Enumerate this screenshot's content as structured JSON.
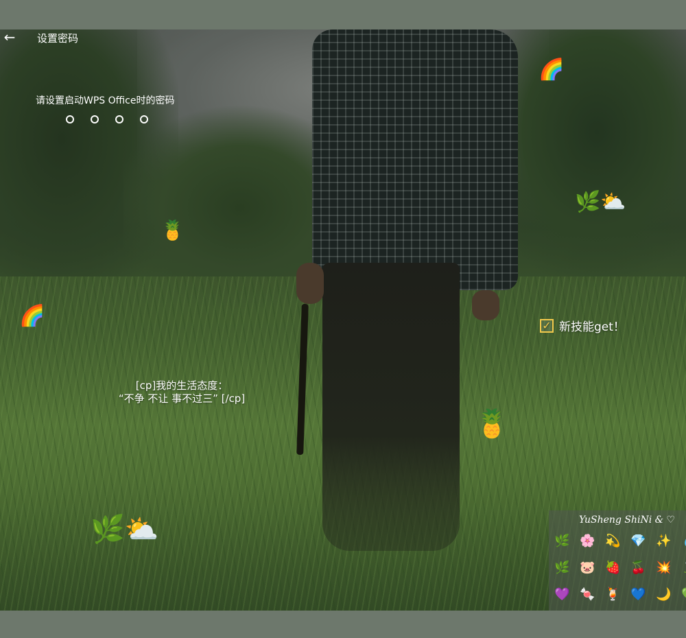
{
  "header": {
    "back_icon": "←",
    "title": "设置密码"
  },
  "password": {
    "prompt": "请设置启动WPS Office时的密码",
    "length": 4,
    "filled": 0
  },
  "overlays": {
    "quote_line1": "[cp]我的生活态度：",
    "quote_line2": "“不争 不让 事不过三” [/cp]",
    "skill_check": "✓",
    "skill_text": "新技能get！"
  },
  "stickers": {
    "rainbow": "🌈",
    "pineapple": "🍍",
    "leaf_cloud": "🌿⛅"
  },
  "emoji_panel": {
    "header": "YuSheng  ShiNi &  ♡",
    "rows": [
      [
        "🌿",
        "🌸",
        "💫",
        "💎",
        "✨",
        "💧"
      ],
      [
        "🌿",
        "🐷",
        "🍓",
        "🍒",
        "💥",
        "🍃"
      ],
      [
        "💜",
        "🍬",
        "🍹",
        "💙",
        "🌙",
        "💚"
      ]
    ]
  },
  "colors": {
    "checkbox": "#f2c94c",
    "text": "#ffffff"
  }
}
